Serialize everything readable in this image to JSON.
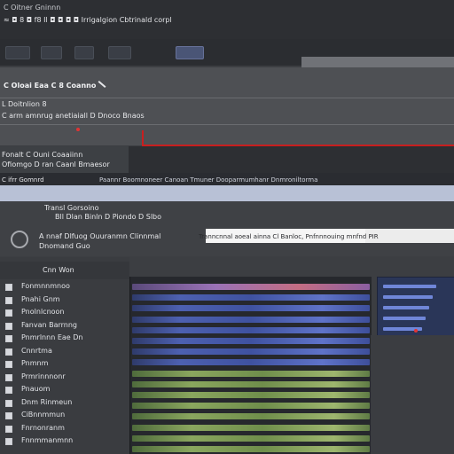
{
  "topbar": {
    "title": "C Oitner Gninnn",
    "menu_text": "≈ ◘ 8 ◘ f8 Il ◘ ◘ ◘ ◘ Irrigalgion Cbtrinald corpl"
  },
  "toolbar": {
    "buttons": [
      "btn1",
      "btn2",
      "btn3",
      "btn4",
      "btn5"
    ]
  },
  "header": {
    "line1": "C Oloai  Eaa C  8  Coanno",
    "line2": "L Doitnlion 8",
    "line3": "C arm amnrug anetiaiall D Dnoco Bnaos",
    "line4": "Fonalt C Ouni Coaaiinn",
    "line5": "Ofiomgo D ran Caanl Bmaesor",
    "line6": "C ifrr Gomnrd"
  },
  "tab_row": "Paannr Boomnoneer  Canoan Tmuner  Dooparmumhanr  Dnmroniltorma",
  "info": {
    "crumb": "Transl Gorsoino",
    "subtitle": "Bll Dlan Binln  D Piondo  D Slbo",
    "name_line": "A nnaf Dlfuog Ouuranmn Clinnmal",
    "sub_line": "Dnomand Guo",
    "title_box": "Tranncnnal aoeal ainna Cl Banloc, Pnfnnnouing mnfnd  PIR"
  },
  "list": {
    "header": "Cnn      Won",
    "items": [
      "Fonmnnmnoo",
      "Pnahi Gnm",
      "Pnolnlcnoon",
      "Fanvan Barrnng",
      "Pnmrlnnn Eae Dn",
      "Cnnrtma",
      "Pnmnm",
      "Prmrinnnonr",
      "Pnauom",
      "Dnm Rinmeun",
      "CiBnnmmun",
      "Fnrnonranm",
      "Fnnmmanmnn"
    ]
  },
  "data_rows": [
    "p",
    "b",
    "b",
    "b",
    "b",
    "b",
    "b",
    "b",
    "g",
    "g",
    "g",
    "g",
    "g",
    "g",
    "g",
    "g"
  ],
  "colors": {
    "accent_red": "#c81f1f",
    "row_blue": "#4d60b0",
    "row_green": "#8aa65e",
    "row_purple": "#9a72b7"
  }
}
